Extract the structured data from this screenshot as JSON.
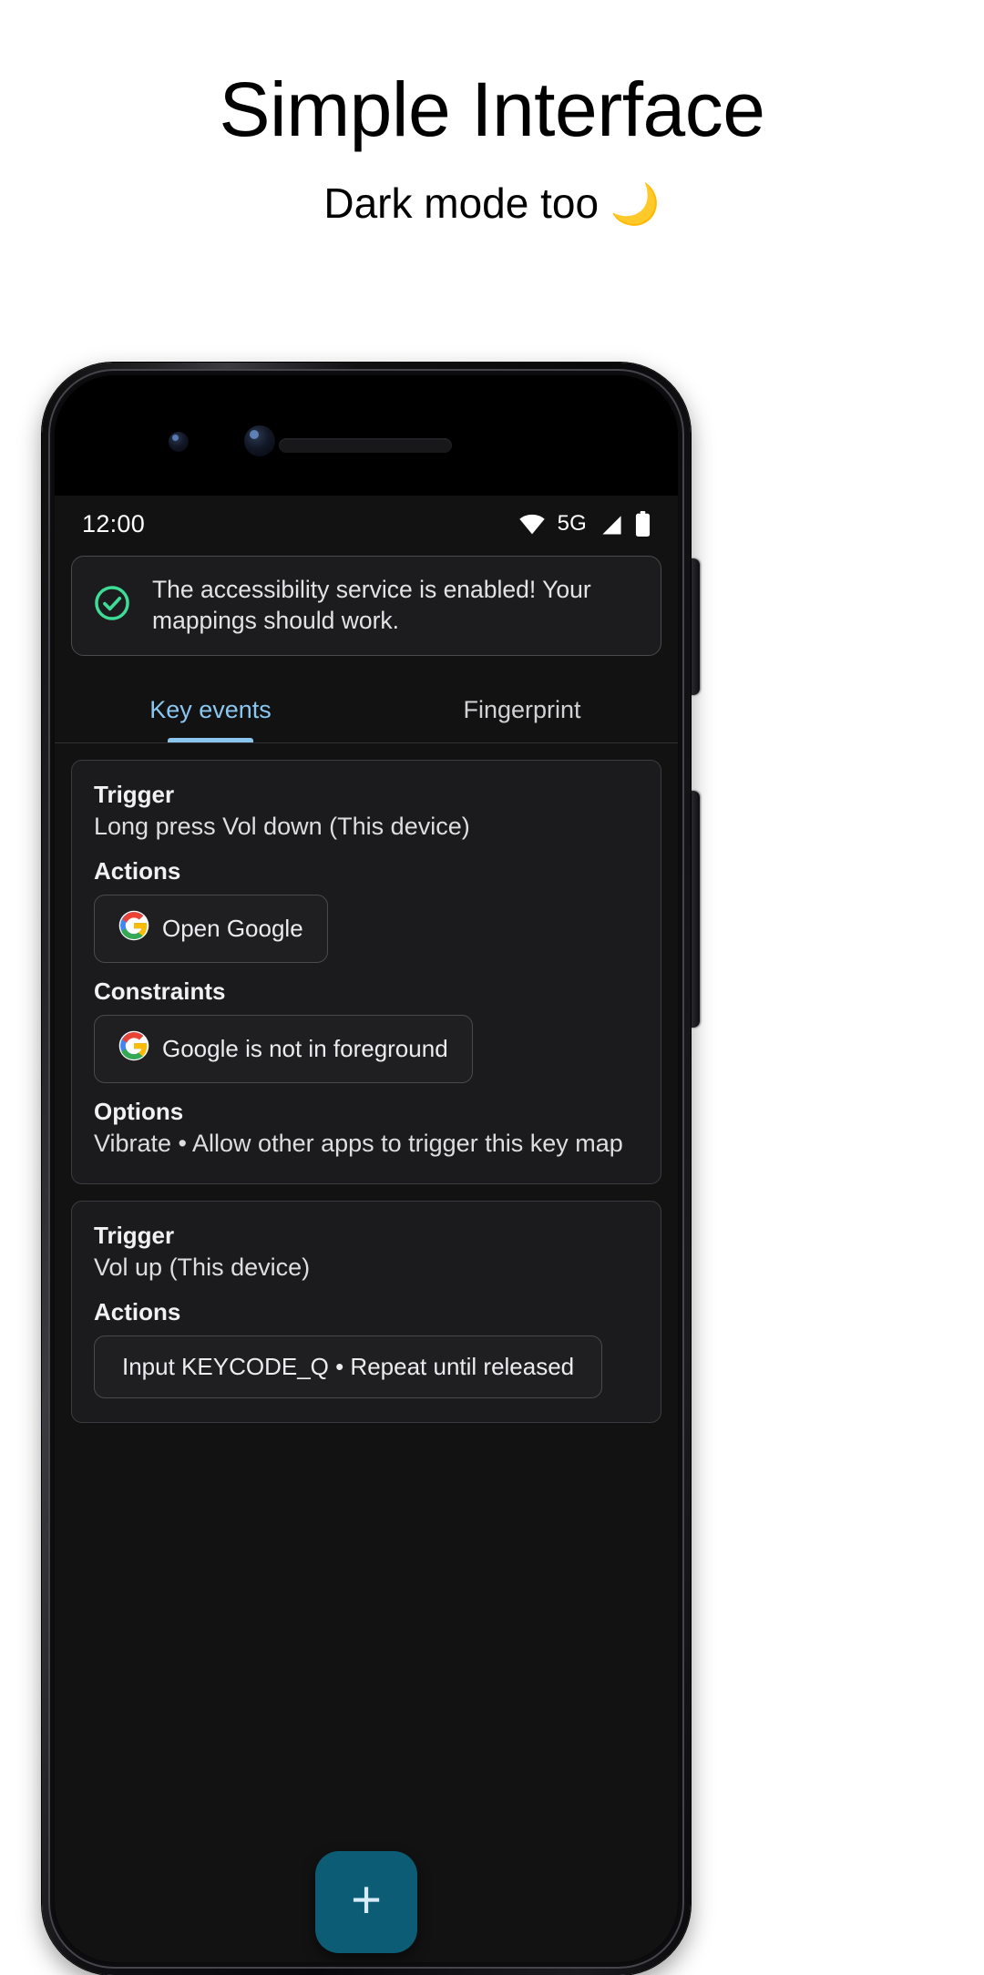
{
  "promo": {
    "title": "Simple Interface",
    "subtitle": "Dark mode too",
    "moon": "🌙"
  },
  "status_bar": {
    "time": "12:00",
    "network_label": "5G",
    "icons": [
      "wifi-icon",
      "signal-icon",
      "battery-icon"
    ]
  },
  "banner": {
    "icon": "check-circle-icon",
    "icon_color": "#3ddc97",
    "text": "The accessibility service is enabled! Your mappings should work."
  },
  "tabs": [
    {
      "label": "Key events",
      "active": true
    },
    {
      "label": "Fingerprint",
      "active": false
    }
  ],
  "theme": {
    "accent": "#8ac6f0",
    "fab_background": "#0d5c75",
    "fab_icon_color": "#d7ecf7",
    "screen_background": "#121212",
    "card_background": "#1b1b1d"
  },
  "labels": {
    "trigger": "Trigger",
    "actions": "Actions",
    "constraints": "Constraints",
    "options": "Options"
  },
  "keymaps": [
    {
      "trigger": "Long press Vol down (This device)",
      "actions": [
        {
          "icon": "google-icon",
          "label": "Open Google"
        }
      ],
      "constraints": [
        {
          "icon": "google-icon",
          "label": "Google is not in foreground"
        }
      ],
      "options": "Vibrate • Allow other apps to trigger this key map"
    },
    {
      "trigger": "Vol up (This device)",
      "actions": [
        {
          "icon": "none",
          "label": "Input KEYCODE_Q • Repeat until released"
        }
      ],
      "constraints": [],
      "options": ""
    }
  ],
  "fab": {
    "label": "+",
    "name": "add-key-map-button"
  }
}
